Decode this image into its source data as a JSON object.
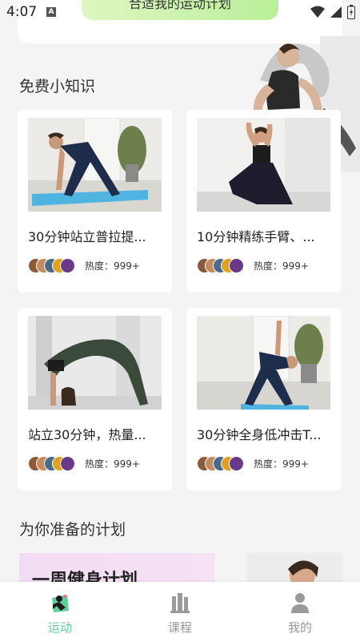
{
  "status_bar": {
    "time": "4:07",
    "notification_icon": "A"
  },
  "top": {
    "plan_button_label": "合适我的运动计划"
  },
  "tips_section": {
    "title": "免费小知识",
    "cards": [
      {
        "title": "30分钟站立普拉提...",
        "heat": "热度：999+"
      },
      {
        "title": "10分钟精练手臂、...",
        "heat": "热度：999+"
      },
      {
        "title": "站立30分钟，热量...",
        "heat": "热度：999+"
      },
      {
        "title": "30分钟全身低冲击T...",
        "heat": "热度：999+"
      }
    ]
  },
  "plans_section": {
    "title": "为你准备的计划",
    "banner_title": "一周健身计划"
  },
  "nav": {
    "items": [
      {
        "label": "运动",
        "icon": "exercise-icon",
        "active": true
      },
      {
        "label": "课程",
        "icon": "course-icon",
        "active": false
      },
      {
        "label": "我的",
        "icon": "profile-icon",
        "active": false
      }
    ]
  },
  "colors": {
    "accent": "#5fcf9a",
    "inactive": "#999999",
    "plan_gradient": "#c5f0a6"
  }
}
